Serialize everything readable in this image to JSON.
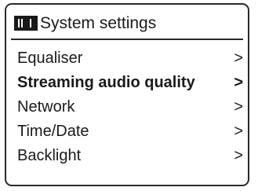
{
  "screen": {
    "title": "System settings",
    "title_icon": "settings-menu-icon"
  },
  "menu": {
    "selected_index": 1,
    "chevron": ">",
    "items": [
      {
        "label": "Equaliser"
      },
      {
        "label": "Streaming audio quality"
      },
      {
        "label": "Network"
      },
      {
        "label": "Time/Date"
      },
      {
        "label": "Backlight"
      }
    ]
  }
}
